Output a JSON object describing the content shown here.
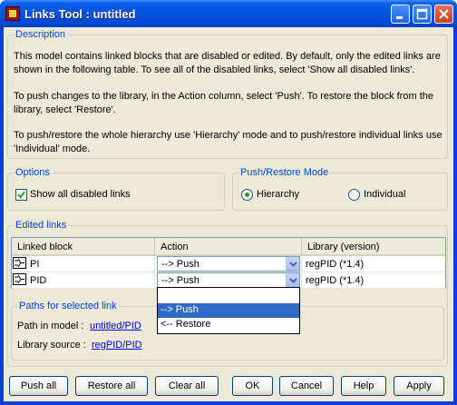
{
  "window": {
    "title": "Links Tool : untitled"
  },
  "description": {
    "label": "Description",
    "line1": "This model contains linked blocks that are disabled or edited. By default, only the edited links are",
    "line2": "shown in the following table. To see all of the disabled links, select 'Show all disabled links'.",
    "line3": "To push changes to the library, in the Action column, select 'Push'. To restore the block from the",
    "line4": "library, select 'Restore'.",
    "line5": "To push/restore the whole hierarchy use 'Hierarchy' mode and to push/restore individual links use",
    "line6": "'Individual' mode."
  },
  "options": {
    "label": "Options",
    "show_all_label": "Show all disabled links",
    "show_all_checked": true
  },
  "mode": {
    "label": "Push/Restore Mode",
    "hierarchy_label": "Hierarchy",
    "individual_label": "Individual",
    "selected": "Hierarchy"
  },
  "edited_links": {
    "label": "Edited links",
    "columns": [
      "Linked block",
      "Action",
      "Library (version)"
    ],
    "rows": [
      {
        "block": "PI",
        "action": "--> Push",
        "library": "regPID (*1.4)"
      },
      {
        "block": "PID",
        "action": "--> Push",
        "library": "regPID (*1.4)"
      }
    ],
    "dropdown_options": [
      "",
      "--> Push",
      "<-- Restore"
    ],
    "dropdown_selected": "--> Push"
  },
  "paths": {
    "label": "Paths for selected link",
    "model_label": "Path in model  :",
    "model_value": "untitled/PID",
    "library_label": "Library source  :",
    "library_value": "regPID/PID"
  },
  "buttons": {
    "push_all": "Push all",
    "restore_all": "Restore all",
    "clear_all": "Clear all",
    "ok": "OK",
    "cancel": "Cancel",
    "help": "Help",
    "apply": "Apply"
  },
  "colors": {
    "title_blue": "#0551e0",
    "group_label": "#0046d5",
    "selection": "#316ac5",
    "link": "#0000ee"
  }
}
